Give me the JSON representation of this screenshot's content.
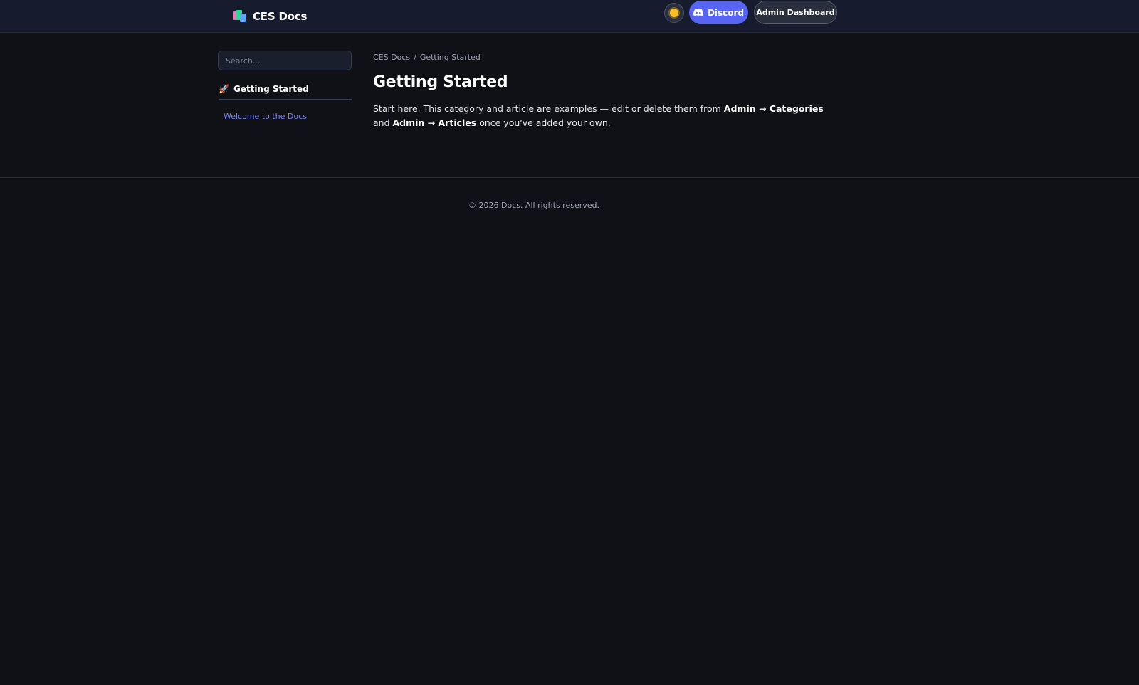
{
  "header": {
    "brand_title": "CES Docs",
    "theme_toggle_icon": "sun-icon",
    "discord_label": "Discord",
    "admin_label": "Admin Dashboard"
  },
  "sidebar": {
    "search_placeholder": "Search...",
    "categories": [
      {
        "icon": "rocket-icon",
        "title": "Getting Started",
        "articles": [
          {
            "label": "Welcome to the Docs"
          }
        ]
      }
    ]
  },
  "main": {
    "breadcrumb": [
      "CES Docs",
      "Getting Started"
    ],
    "breadcrumb_separator": "/",
    "title": "Getting Started",
    "body": {
      "p1": "Start here. This category and article are examples — edit or delete them from ",
      "b1": "Admin → Categories",
      "p2": " and ",
      "b2": "Admin → Articles",
      "p3": " once you've added your own."
    }
  },
  "footer": {
    "text": "© 2026 Docs. All rights reserved."
  },
  "colors": {
    "background": "#0f1117",
    "topbar": "#161b2e",
    "discord": "#5865f2",
    "link": "#7b84f7"
  }
}
